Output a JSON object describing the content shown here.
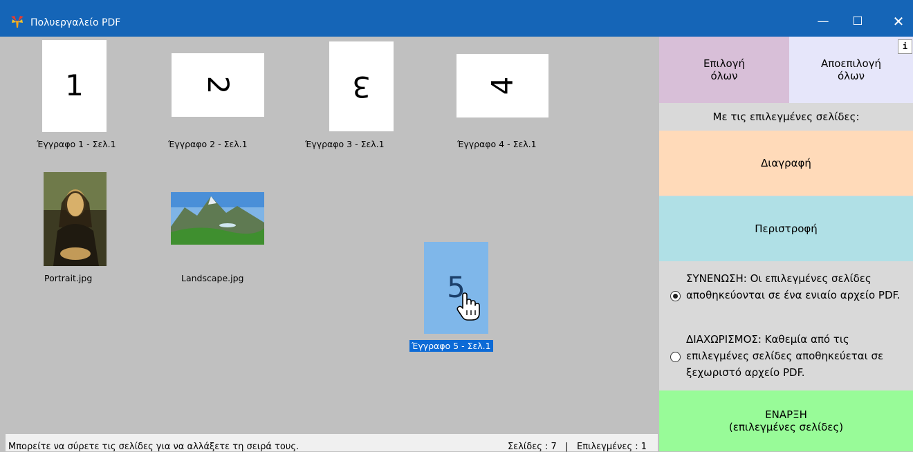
{
  "window": {
    "title": "Πολυεργαλείο PDF",
    "controls": {
      "minimize": "—",
      "maximize": "☐",
      "close": "✕"
    }
  },
  "pages": [
    {
      "digit": "1",
      "caption": "Έγγραφο 1 - Σελ.1"
    },
    {
      "digit": "2",
      "caption": "Έγγραφο 2 - Σελ.1"
    },
    {
      "digit": "3",
      "caption": "Έγγραφο 3 - Σελ.1"
    },
    {
      "digit": "4",
      "caption": "Έγγραφο 4 - Σελ.1"
    },
    {
      "caption": "Portrait.jpg"
    },
    {
      "caption": "Landscape.jpg"
    },
    {
      "digit": "5",
      "caption": "Έγγραφο 5 - Σελ.1"
    }
  ],
  "panel": {
    "info": "i",
    "select_all": "Επιλογή\nόλων",
    "deselect_all": "Αποεπιλογή\nόλων",
    "with_selected": "Με τις επιλεγμένες σελίδες:",
    "delete": "Διαγραφή",
    "rotate": "Περιστροφή",
    "merge_option": "ΣΥΝΕΝΩΣΗ: Οι επιλεγμένες σελίδες αποθηκεύονται σε ένα ενιαίο αρχείο PDF.",
    "split_option": "ΔΙΑΧΩΡΙΣΜΟΣ: Καθεμία από τις επιλεγμένες σελίδες αποθηκεύεται σε ξεχωριστό αρχείο PDF.",
    "merge_selected": true,
    "start": "ΕΝΑΡΞΗ\n(επιλεγμένες σελίδες)"
  },
  "status": {
    "hint": "Μπορείτε να σύρετε τις σελίδες για να αλλάξετε τη σειρά τους.",
    "counts": "Σελίδες : 7   |   Επιλεγμένες : 1"
  },
  "colors": {
    "titlebar": "#1565b7",
    "select_all_bg": "#d8bfd8",
    "deselect_all_bg": "#e6e6fa",
    "delete_bg": "#ffdab9",
    "rotate_bg": "#b0e0e6",
    "start_bg": "#98fb98",
    "selection": "#0c6ad6"
  },
  "icons": [
    "app-logo-icon",
    "hand-cursor-icon"
  ]
}
